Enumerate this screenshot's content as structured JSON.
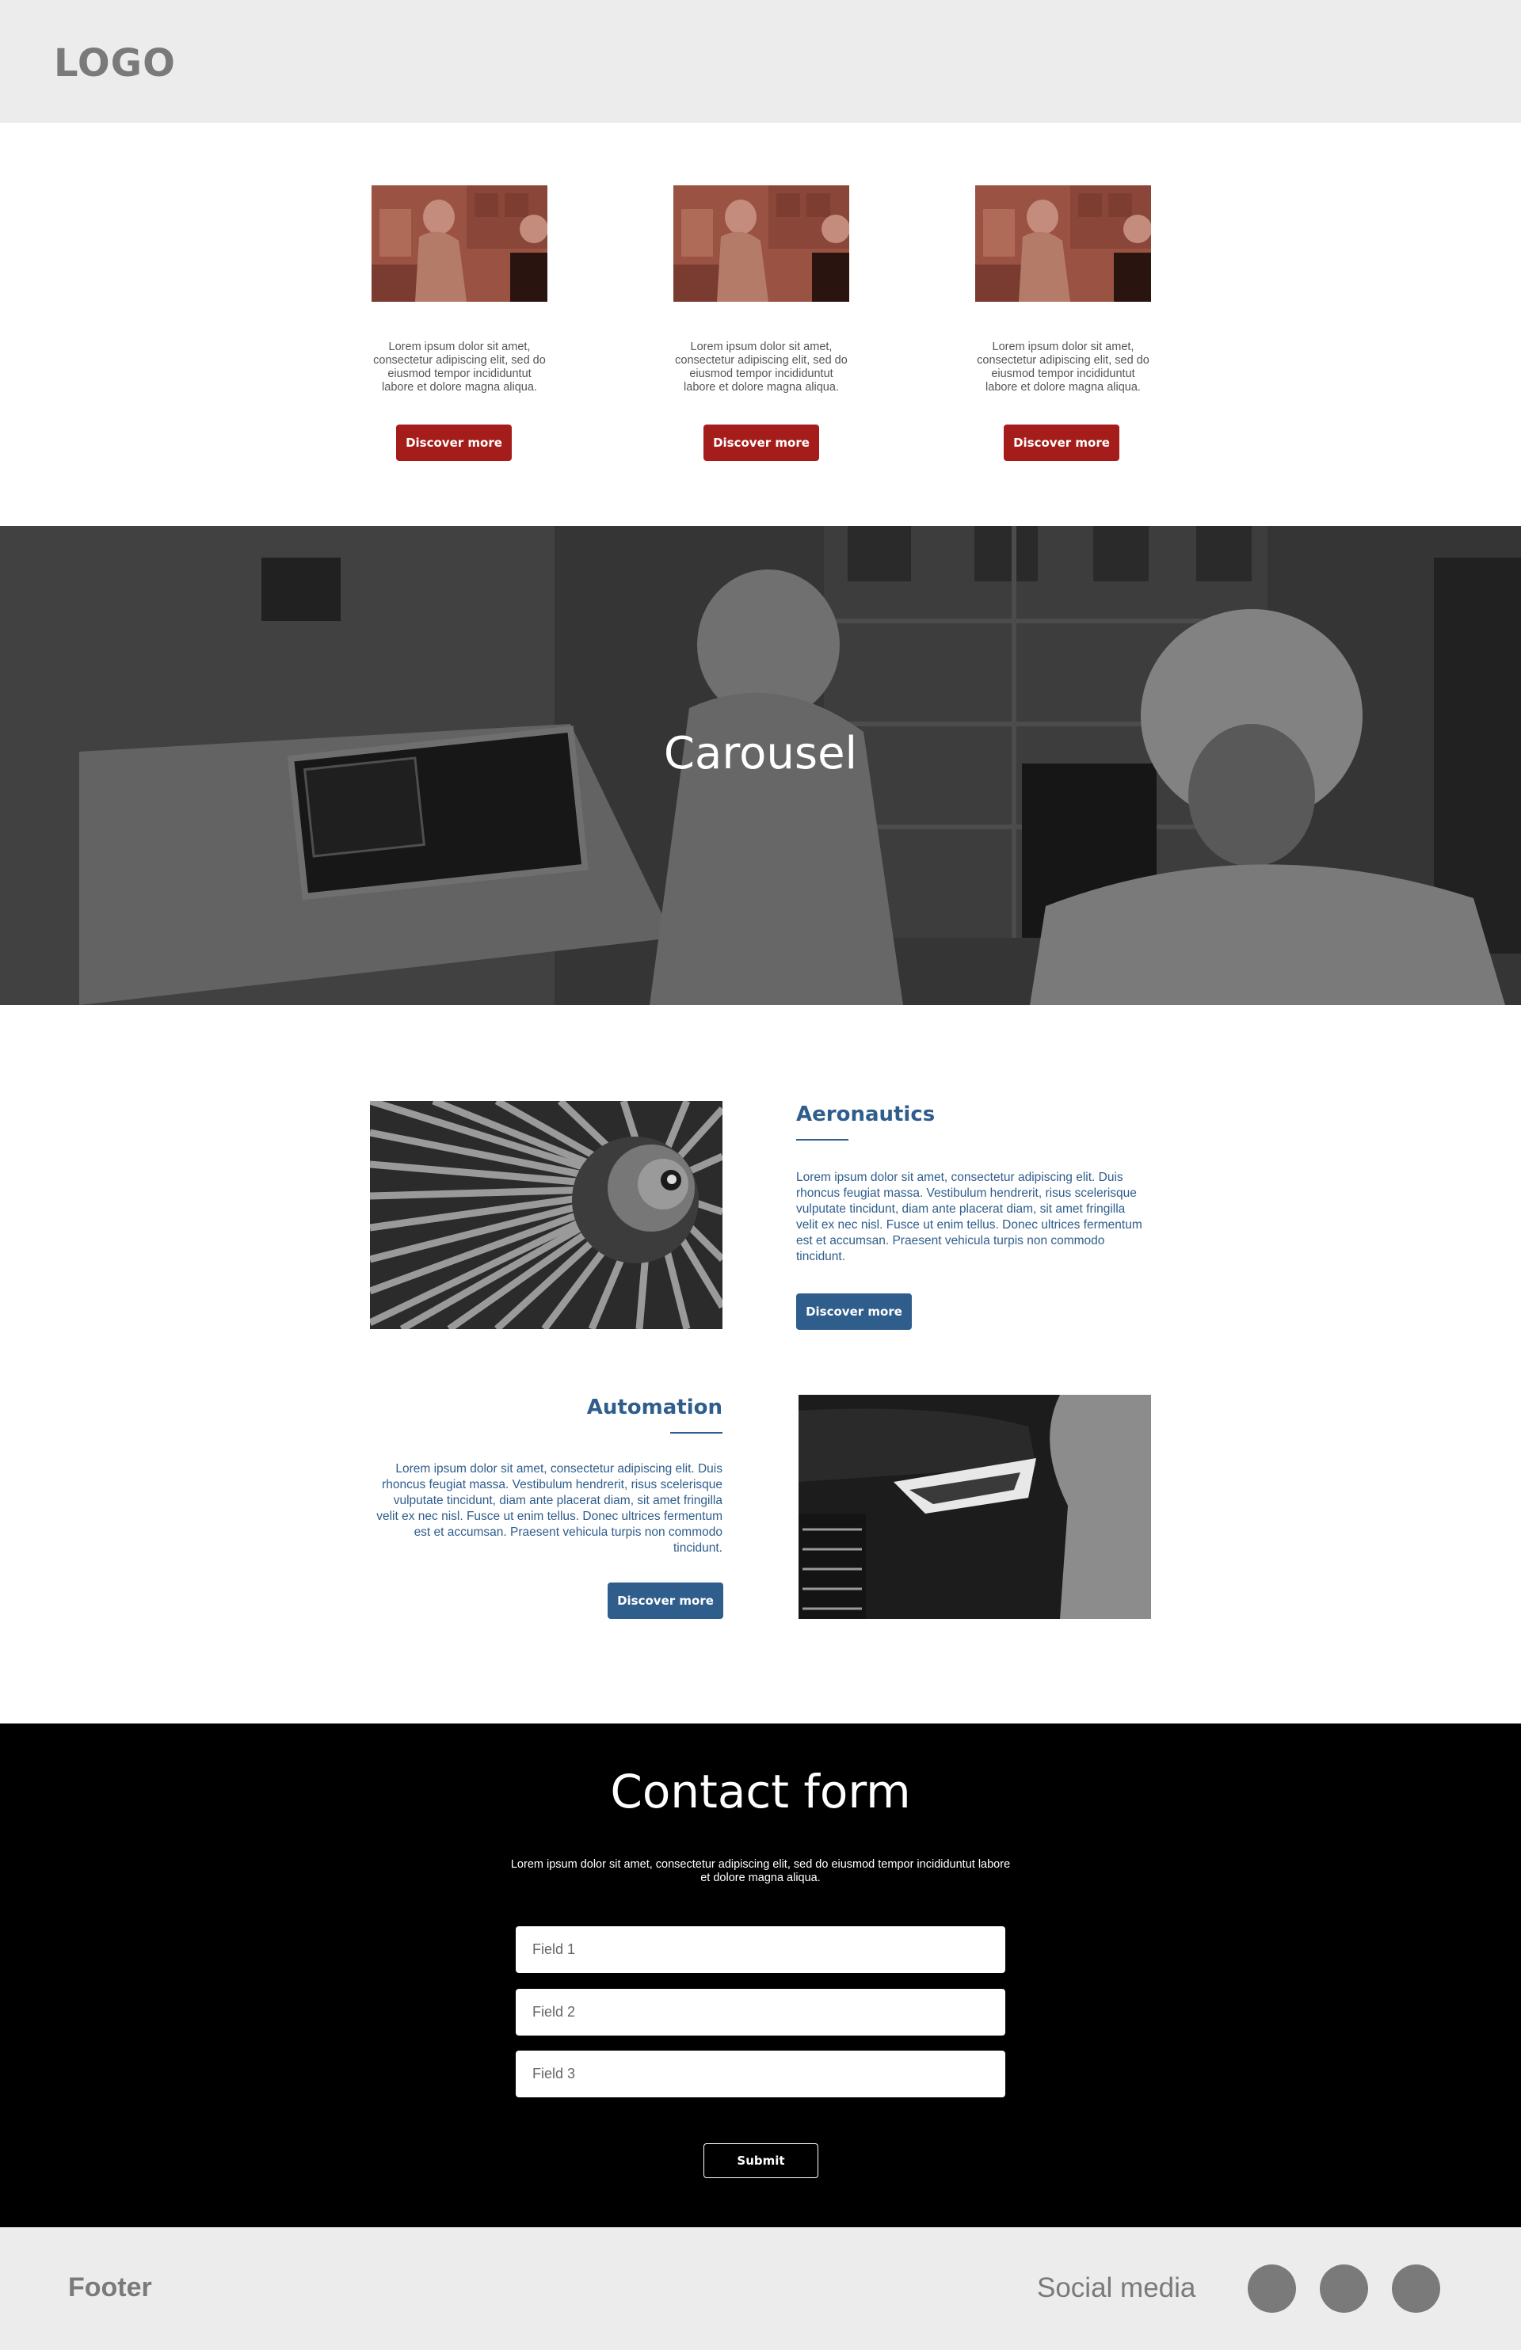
{
  "header": {
    "logo": "LOGO"
  },
  "cards": [
    {
      "text": "Lorem ipsum dolor sit amet, consectetur adipiscing elit, sed do eiusmod tempor incididuntut labore et dolore magna aliqua.",
      "button": "Discover more"
    },
    {
      "text": "Lorem ipsum dolor sit amet, consectetur adipiscing elit, sed do eiusmod tempor incididuntut labore et dolore magna aliqua.",
      "button": "Discover more"
    },
    {
      "text": "Lorem ipsum dolor sit amet, consectetur adipiscing elit, sed do eiusmod tempor incididuntut labore et dolore magna aliqua.",
      "button": "Discover more"
    }
  ],
  "carousel": {
    "title": "Carousel"
  },
  "features": [
    {
      "title": "Aeronautics",
      "text": "Lorem ipsum dolor sit amet, consectetur adipiscing elit. Duis rhoncus feugiat massa. Vestibulum hendrerit, risus scelerisque vulputate tincidunt, diam ante placerat diam, sit amet fringilla velit ex nec nisl. Fusce ut enim tellus. Donec ultrices fermentum est et accumsan. Praesent vehicula turpis non commodo tincidunt.",
      "button": "Discover more"
    },
    {
      "title": "Automation",
      "text": "Lorem ipsum dolor sit amet, consectetur adipiscing elit. Duis rhoncus feugiat massa. Vestibulum hendrerit, risus scelerisque vulputate tincidunt, diam ante placerat diam, sit amet fringilla velit ex nec nisl. Fusce ut enim tellus. Donec ultrices fermentum est et accumsan. Praesent vehicula turpis non commodo tincidunt.",
      "button": "Discover more"
    }
  ],
  "contact": {
    "title": "Contact form",
    "text": "Lorem ipsum dolor sit amet, consectetur adipiscing elit, sed do eiusmod tempor incididuntut labore et dolore magna aliqua.",
    "fields": [
      "Field 1",
      "Field 2",
      "Field 3"
    ],
    "submit": "Submit"
  },
  "footer": {
    "label": "Footer",
    "social_label": "Social media"
  },
  "colors": {
    "accent_red": "#a51d1a",
    "accent_blue": "#2f5d8c",
    "header_bg": "#ececec",
    "contact_bg": "#000000"
  },
  "icons": [
    "social-media-icon",
    "social-media-icon",
    "social-media-icon"
  ]
}
